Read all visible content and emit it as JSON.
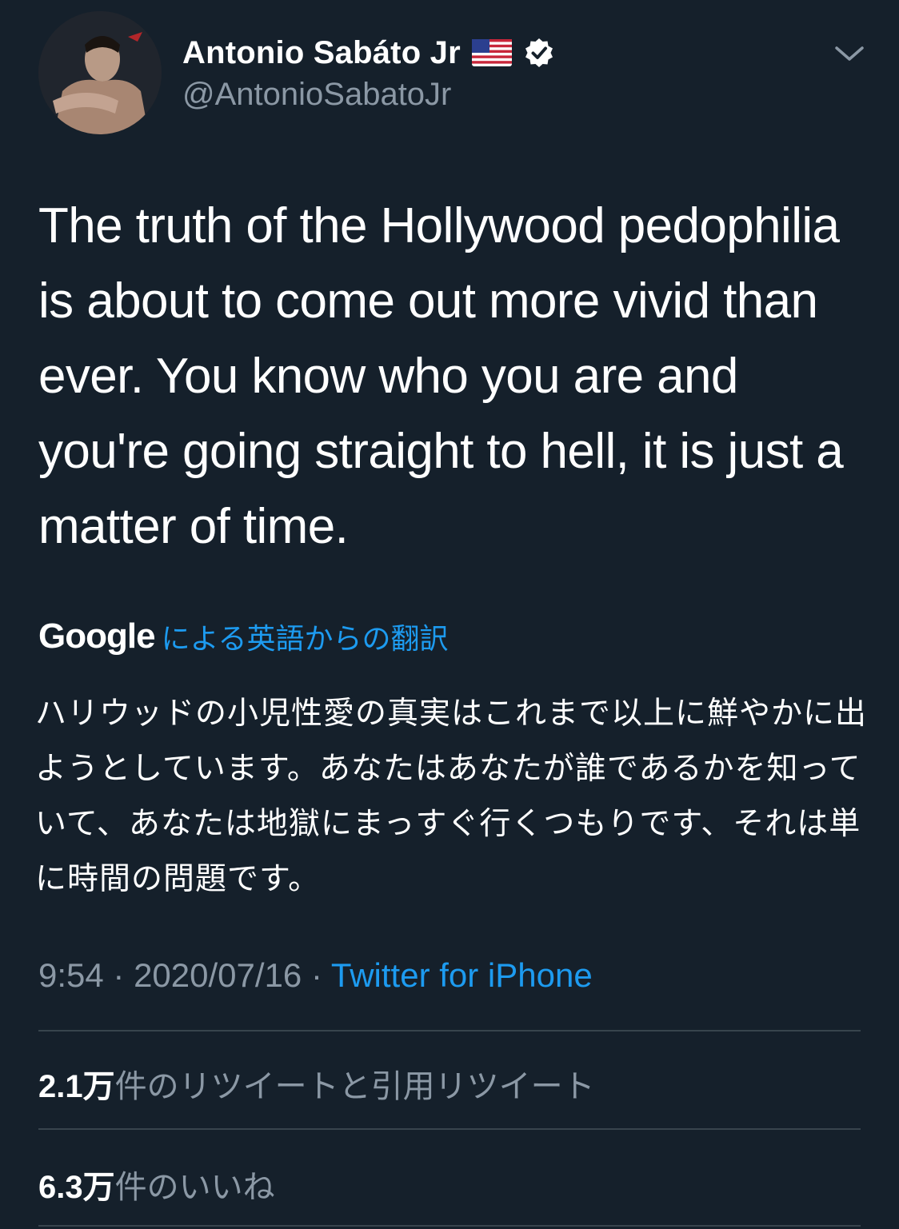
{
  "header": {
    "display_name": "Antonio Sabáto Jr",
    "handle": "@AntonioSabatoJr",
    "icons": {
      "flag": "us-flag-icon",
      "verified": "verified-badge-icon",
      "menu": "chevron-down-icon"
    }
  },
  "tweet": {
    "text": "The truth of the Hollywood pedophilia is about to come out more vivid than ever. You know who you are and you're going straight to hell, it is just a matter of time."
  },
  "translation": {
    "provider": "Google",
    "note": "による英語からの翻訳",
    "text": "ハリウッドの小児性愛の真実はこれまで以上に鮮やかに出ようとしています。あなたはあなたが誰であるかを知っていて、あなたは地獄にまっすぐ行くつもりです、それは単に時間の問題です。"
  },
  "meta": {
    "time": "9:54",
    "separator": " · ",
    "date": "2020/07/16",
    "source": "Twitter for iPhone"
  },
  "stats": {
    "retweets": {
      "count": "2.1万",
      "label": "件のリツイートと引用リツイート"
    },
    "likes": {
      "count": "6.3万",
      "label": "件のいいね"
    }
  },
  "colors": {
    "background": "#15202b",
    "text": "#ffffff",
    "secondary_text": "#8b98a5",
    "link": "#1d9bf0",
    "divider": "#38444d",
    "verified_badge": "#ffffff"
  }
}
